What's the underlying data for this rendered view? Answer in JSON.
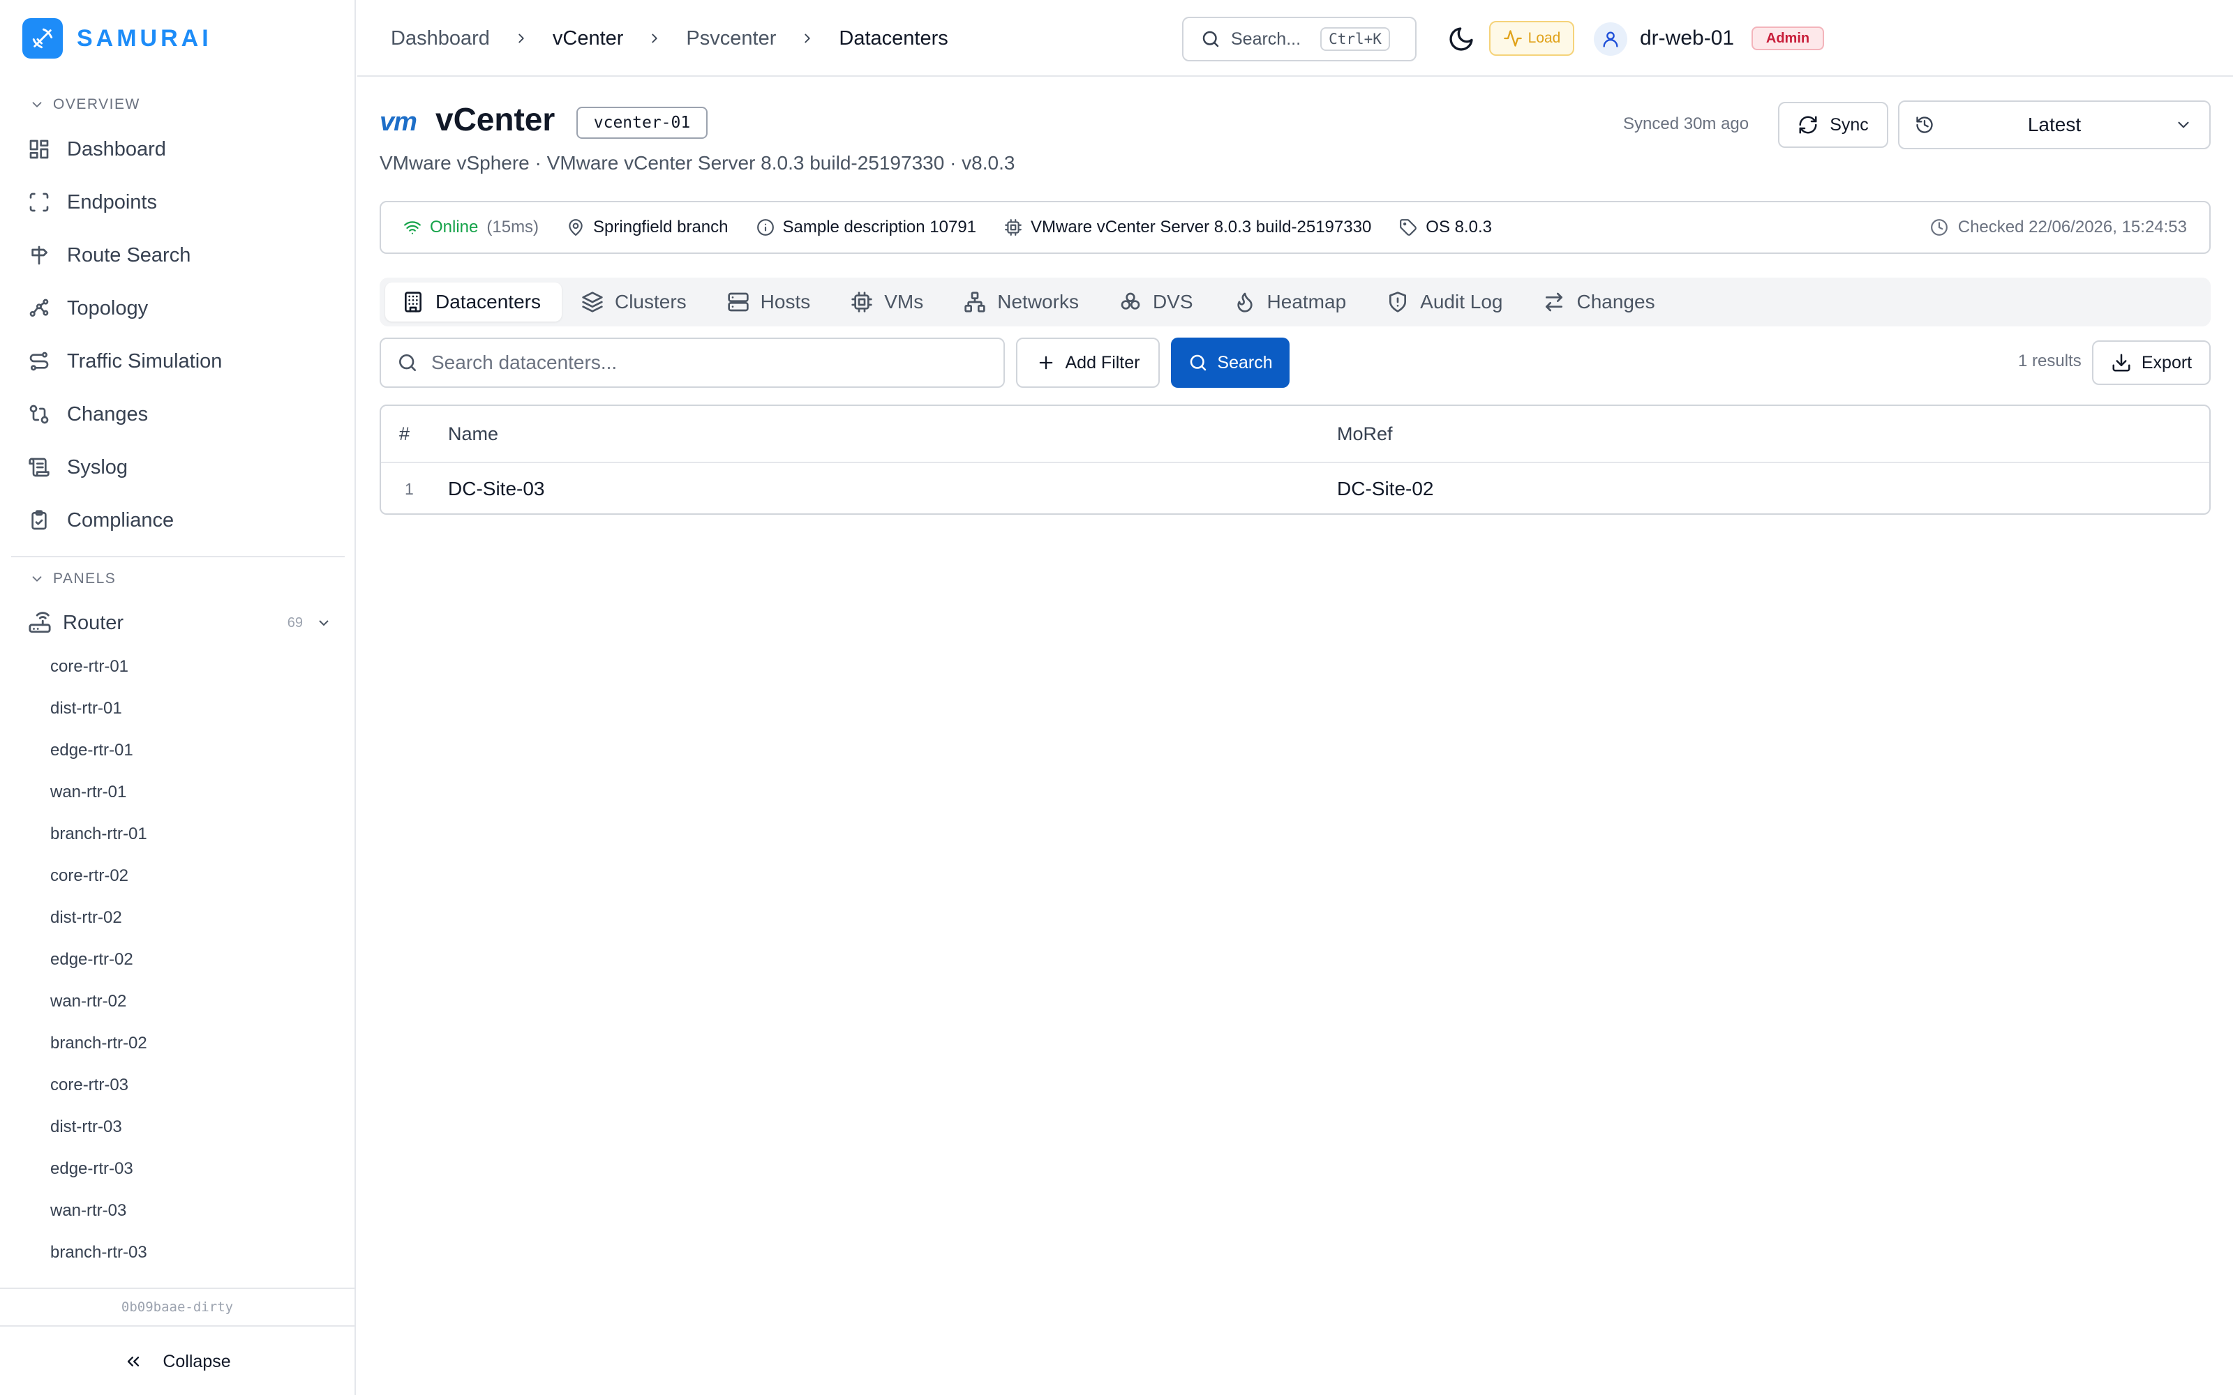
{
  "brand": {
    "name": "SAMURAI"
  },
  "sidebar": {
    "overview_label": "OVERVIEW",
    "items": [
      {
        "label": "Dashboard",
        "icon": "dashboard-icon"
      },
      {
        "label": "Endpoints",
        "icon": "endpoints-icon"
      },
      {
        "label": "Route Search",
        "icon": "signpost-icon"
      },
      {
        "label": "Topology",
        "icon": "topology-icon"
      },
      {
        "label": "Traffic Simulation",
        "icon": "route-icon"
      },
      {
        "label": "Changes",
        "icon": "git-compare-icon"
      },
      {
        "label": "Syslog",
        "icon": "scroll-icon"
      },
      {
        "label": "Compliance",
        "icon": "clipboard-check-icon"
      }
    ],
    "panels_label": "PANELS",
    "router": {
      "label": "Router",
      "count": "69"
    },
    "routers": [
      "core-rtr-01",
      "dist-rtr-01",
      "edge-rtr-01",
      "wan-rtr-01",
      "branch-rtr-01",
      "core-rtr-02",
      "dist-rtr-02",
      "edge-rtr-02",
      "wan-rtr-02",
      "branch-rtr-02",
      "core-rtr-03",
      "dist-rtr-03",
      "edge-rtr-03",
      "wan-rtr-03",
      "branch-rtr-03"
    ],
    "build": "0b09baae-dirty",
    "collapse_label": "Collapse"
  },
  "topbar": {
    "breadcrumbs": [
      "Dashboard",
      "vCenter",
      "Psvcenter",
      "Datacenters"
    ],
    "search_label": "Search...",
    "search_shortcut": "Ctrl+K",
    "load_label": "Load",
    "user": "dr-web-01",
    "role": "Admin"
  },
  "header": {
    "logo": "vm",
    "title": "vCenter",
    "instance": "vcenter-01",
    "subtitle": "VMware vSphere · VMware vCenter Server 8.0.3 build-25197330 · v8.0.3",
    "synced": "Synced 30m ago",
    "sync_label": "Sync",
    "version": "Latest"
  },
  "info": {
    "status": "Online",
    "latency": "(15ms)",
    "location": "Springfield branch",
    "description": "Sample description 10791",
    "product": "VMware vCenter Server 8.0.3 build-25197330",
    "os": "OS 8.0.3",
    "checked": "Checked 22/06/2026, 15:24:53"
  },
  "tabs": [
    {
      "label": "Datacenters",
      "icon": "building-icon",
      "active": true
    },
    {
      "label": "Clusters",
      "icon": "layers-icon"
    },
    {
      "label": "Hosts",
      "icon": "server-icon"
    },
    {
      "label": "VMs",
      "icon": "cpu-icon"
    },
    {
      "label": "Networks",
      "icon": "network-icon"
    },
    {
      "label": "DVS",
      "icon": "boxes-icon"
    },
    {
      "label": "Heatmap",
      "icon": "flame-icon"
    },
    {
      "label": "Audit Log",
      "icon": "shield-icon"
    },
    {
      "label": "Changes",
      "icon": "arrows-icon"
    }
  ],
  "toolbar": {
    "search_placeholder": "Search datacenters...",
    "add_filter": "Add Filter",
    "search": "Search",
    "results": "1 results",
    "export": "Export"
  },
  "table": {
    "columns": [
      "#",
      "Name",
      "MoRef"
    ],
    "rows": [
      {
        "num": "1",
        "name": "DC-Site-03",
        "moref": "DC-Site-02"
      }
    ]
  },
  "colors": {
    "brand": "#1d8cf8",
    "primary_button": "#0b5cc4",
    "online": "#16a34a",
    "load": "#e0a21a",
    "admin": "#c81e3a"
  }
}
